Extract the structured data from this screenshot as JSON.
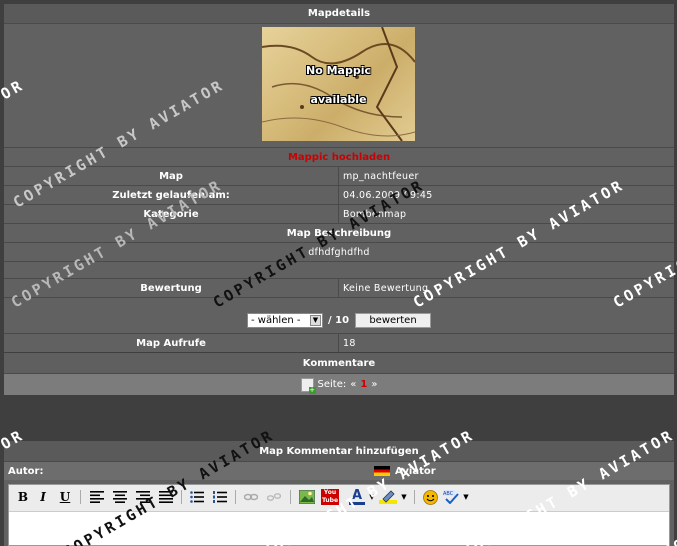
{
  "mapdetails": {
    "title": "Mapdetails",
    "image_text_line1": "No Mappic",
    "image_text_line2": "available",
    "upload_link": "Mappic hochladen",
    "rows": [
      {
        "label": "Map",
        "value": "mp_nachtfeuer"
      },
      {
        "label": "Zuletzt gelaufen am:",
        "value": "04.06.2009 09:45"
      },
      {
        "label": "Kategorie",
        "value": "Bombenmap"
      }
    ],
    "description_title": "Map Beschreibung",
    "description": "dfhdfghdfhd",
    "rating_label": "Bewertung",
    "rating_value": "Keine Bewertung",
    "rating_select": "- wählen -",
    "rating_max": "/ 10",
    "rate_button": "bewerten",
    "views_label": "Map Aufrufe",
    "views_value": "18"
  },
  "comments": {
    "title": "Kommentare",
    "page_label": "Seite:",
    "prev": "«",
    "current_page": "1",
    "next": "»"
  },
  "add_comment": {
    "title": "Map Kommentar hinzufügen",
    "author_label": "Autor:",
    "author_name": "Aviator"
  },
  "toolbar": {
    "bold": "B",
    "italic": "I",
    "underline": "U",
    "youtube": "You Tube",
    "font_color": "A"
  },
  "watermark": "COPYRIGHT BY AVIATOR",
  "colors": {
    "upload_link": "#cc0000",
    "current_page": "#cc0000",
    "background": "#3f3f3f",
    "panel": "#616161"
  }
}
